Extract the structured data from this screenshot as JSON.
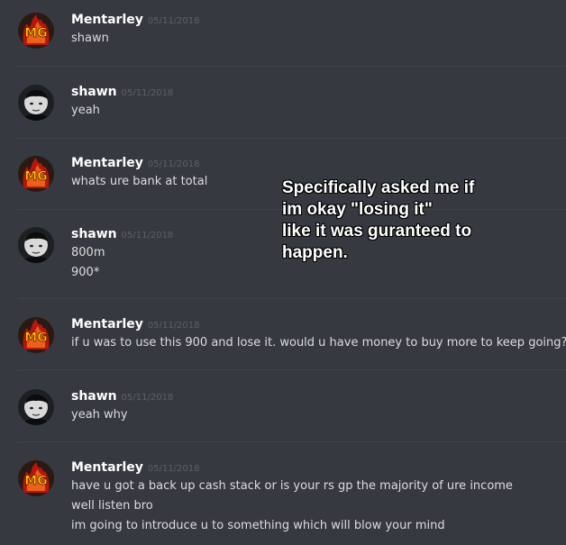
{
  "messages": [
    {
      "username": "Mentarley",
      "timestamp": "05/11/2018",
      "avatar": "mentarley-mg-logo-avatar",
      "lines": [
        "shawn"
      ]
    },
    {
      "username": "shawn",
      "timestamp": "05/11/2018",
      "avatar": "shawn-photo-avatar",
      "lines": [
        "yeah"
      ]
    },
    {
      "username": "Mentarley",
      "timestamp": "05/11/2018",
      "avatar": "mentarley-mg-logo-avatar",
      "lines": [
        "whats ure bank at total"
      ]
    },
    {
      "username": "shawn",
      "timestamp": "05/11/2018",
      "avatar": "shawn-photo-avatar",
      "lines": [
        "800m",
        "900*"
      ]
    },
    {
      "username": "Mentarley",
      "timestamp": "05/11/2018",
      "avatar": "mentarley-mg-logo-avatar",
      "lines": [
        "if u was to use this 900 and lose it. would u have money to buy more to keep going?"
      ]
    },
    {
      "username": "shawn",
      "timestamp": "05/11/2018",
      "avatar": "shawn-photo-avatar",
      "lines": [
        "yeah why"
      ]
    },
    {
      "username": "Mentarley",
      "timestamp": "05/11/2018",
      "avatar": "mentarley-mg-logo-avatar",
      "lines": [
        "have u got a back up cash stack or is your rs gp the majority of ure income",
        "well listen bro",
        "im going to introduce u to something which will blow your mind"
      ]
    }
  ],
  "annotation": {
    "lines": [
      "Specifically asked me if",
      "im okay \"losing it\"",
      "like it was guranteed to",
      "happen."
    ]
  },
  "colors": {
    "background": "#36393f",
    "username": "#ffffff",
    "message_text": "#dcddde",
    "timestamp": "#5d6066",
    "divider": "#40434a",
    "mg_logo_orange": "#e8621a",
    "mg_logo_red": "#b8150f"
  }
}
